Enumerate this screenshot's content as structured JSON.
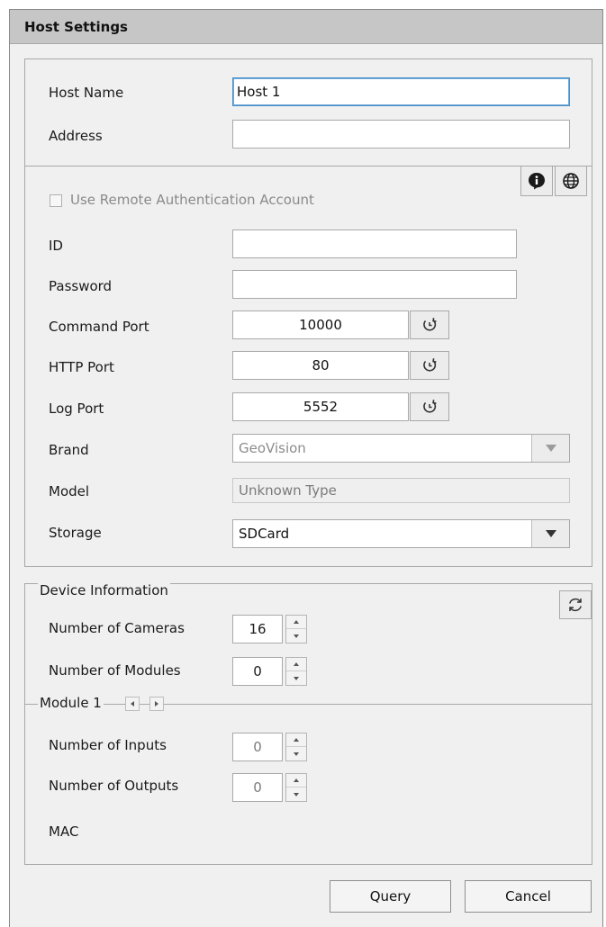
{
  "window": {
    "title": "Host Settings"
  },
  "host": {
    "name_label": "Host Name",
    "name_value": "Host 1",
    "address_label": "Address",
    "address_value": ""
  },
  "auth": {
    "remote_auth_label": "Use Remote Authentication Account",
    "remote_auth_checked": false,
    "id_label": "ID",
    "id_value": "",
    "password_label": "Password",
    "password_value": ""
  },
  "ports": {
    "command_label": "Command Port",
    "command_value": "10000",
    "http_label": "HTTP Port",
    "http_value": "80",
    "log_label": "Log Port",
    "log_value": "5552"
  },
  "device": {
    "brand_label": "Brand",
    "brand_value": "GeoVision",
    "model_label": "Model",
    "model_value": "Unknown Type",
    "storage_label": "Storage",
    "storage_value": "SDCard"
  },
  "device_info": {
    "group_title": "Device Information",
    "cameras_label": "Number of Cameras",
    "cameras_value": "16",
    "modules_label": "Number of Modules",
    "modules_value": "0",
    "module_group_title": "Module 1",
    "inputs_label": "Number of Inputs",
    "inputs_value": "0",
    "outputs_label": "Number of Outputs",
    "outputs_value": "0",
    "mac_label": "MAC",
    "mac_value": ""
  },
  "buttons": {
    "query": "Query",
    "cancel": "Cancel"
  },
  "icons": {
    "info": "info-icon",
    "globe": "globe-icon",
    "reset": "reset-icon",
    "refresh": "refresh-icon"
  },
  "colors": {
    "titlebar": "#c6c6c6",
    "focus": "#4a8fc8",
    "background": "#f0f0f0"
  }
}
